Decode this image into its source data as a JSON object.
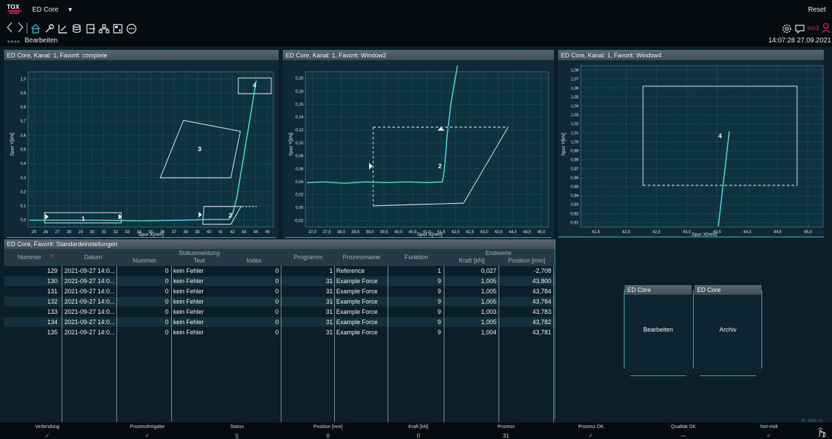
{
  "app": {
    "logo": "TOX",
    "title": "ED Core",
    "reset_label": "Reset",
    "breadcrumb": "Bearbeiten",
    "clock": "14:07:28  27.09.2021",
    "user": "tox3",
    "accent": "#3fb2b8",
    "brand": "#d4197a"
  },
  "toolbar": {
    "icons": [
      "home-icon",
      "wrench-icon",
      "edit-chart-icon",
      "database-icon",
      "export-icon",
      "network-icon",
      "calculator-icon",
      "more-icon"
    ]
  },
  "charts": [
    {
      "title": "ED Core,  Kanal: 1, Favorit: complete",
      "xlabel": "Spur X[mm]",
      "ylabel": "Spur Y[kN]",
      "xticks": [
        "25",
        "26",
        "27",
        "28",
        "29",
        "30",
        "31",
        "32",
        "33",
        "34",
        "35",
        "36",
        "37",
        "38",
        "39",
        "40",
        "41",
        "42",
        "43",
        "44",
        "45"
      ],
      "yticks": [
        "0,0",
        "0,1",
        "0,2",
        "0,3",
        "0,4",
        "0,5",
        "0,6",
        "0,7",
        "0,8",
        "0,9",
        "1,0"
      ],
      "window_labels": [
        "1",
        "2",
        "3",
        "4"
      ]
    },
    {
      "title": "ED Core,  Kanal: 1, Favorit: Window2",
      "xlabel": "Spur X[mm]",
      "ylabel": "Spur Y[kN]",
      "xticks": [
        "37,0",
        "37,5",
        "38,0",
        "38,5",
        "39,0",
        "39,5",
        "40,0",
        "40,5",
        "41,0",
        "41,5",
        "42,0",
        "42,5",
        "43,0",
        "43,5",
        "44,0",
        "44,5",
        "45,0"
      ],
      "yticks": [
        "-0,02",
        "0,00",
        "0,02",
        "0,04",
        "0,06",
        "0,08",
        "0,10",
        "0,12",
        "0,14",
        "0,16",
        "0,18",
        "0,20"
      ],
      "window_labels": [
        "2"
      ]
    },
    {
      "title": "ED Core,  Kanal: 1, Favorit: Window4",
      "xlabel": "Spur X[mm]",
      "ylabel": "Spur Y[kN]",
      "xticks": [
        "41,5",
        "42,0",
        "42,5",
        "43,0",
        "43,5",
        "44,0",
        "44,5",
        "45,0"
      ],
      "yticks": [
        "0,91",
        "0,92",
        "0,93",
        "0,94",
        "0,95",
        "0,96",
        "0,97",
        "0,98",
        "0,99",
        "1,00",
        "1,01",
        "1,02",
        "1,03",
        "1,04",
        "1,05",
        "1,06",
        "1,07",
        "1,08"
      ],
      "window_labels": [
        "4"
      ]
    }
  ],
  "table": {
    "title": "ED Core,  Favorit: Standardeinstellungen",
    "groups": {
      "status": "Statusmeldung",
      "endwerte": "Endwerte"
    },
    "columns": {
      "nummer": "Nummer",
      "datum": "Datum",
      "st_nummer": "Nummer",
      "st_text": "Text",
      "st_index": "Index",
      "programm": "Programm",
      "prozessname": "Prozessname",
      "funktion": "Funktion",
      "kraft": "Kraft [kN]",
      "position": "Position [mm]"
    },
    "rows": [
      {
        "nummer": "129",
        "datum": "2021-09-27 14:0...",
        "st_nummer": "0",
        "st_text": "kein Fehler",
        "st_index": "0",
        "programm": "1",
        "prozessname": "Reference",
        "funktion": "1",
        "kraft": "0,027",
        "position": "-2,708"
      },
      {
        "nummer": "130",
        "datum": "2021-09-27 14:0...",
        "st_nummer": "0",
        "st_text": "kein Fehler",
        "st_index": "0",
        "programm": "31",
        "prozessname": "Example Force",
        "funktion": "9",
        "kraft": "1,005",
        "position": "43,800"
      },
      {
        "nummer": "131",
        "datum": "2021-09-27 14:0...",
        "st_nummer": "0",
        "st_text": "kein Fehler",
        "st_index": "0",
        "programm": "31",
        "prozessname": "Example Force",
        "funktion": "9",
        "kraft": "1,005",
        "position": "43,784"
      },
      {
        "nummer": "132",
        "datum": "2021-09-27 14:0...",
        "st_nummer": "0",
        "st_text": "kein Fehler",
        "st_index": "0",
        "programm": "31",
        "prozessname": "Example Force",
        "funktion": "9",
        "kraft": "1,005",
        "position": "43,784"
      },
      {
        "nummer": "133",
        "datum": "2021-09-27 14:0...",
        "st_nummer": "0",
        "st_text": "kein Fehler",
        "st_index": "0",
        "programm": "31",
        "prozessname": "Example Force",
        "funktion": "9",
        "kraft": "1,003",
        "position": "43,783"
      },
      {
        "nummer": "134",
        "datum": "2021-09-27 14:0...",
        "st_nummer": "0",
        "st_text": "kein Fehler",
        "st_index": "0",
        "programm": "31",
        "prozessname": "Example Force",
        "funktion": "9",
        "kraft": "1,005",
        "position": "43,782"
      },
      {
        "nummer": "135",
        "datum": "2021-09-27 14:0...",
        "st_nummer": "0",
        "st_text": "kein Fehler",
        "st_index": "0",
        "programm": "31",
        "prozessname": "Example Force",
        "funktion": "9",
        "kraft": "1,004",
        "position": "43,781"
      }
    ]
  },
  "tiles": [
    {
      "header": "ED Core",
      "label": "Bearbeiten"
    },
    {
      "header": "ED Core",
      "label": "Archiv"
    }
  ],
  "status_bar": {
    "resolution": "W: 1920; H: 1017",
    "items": [
      {
        "label": "Verbindung",
        "value": "✓"
      },
      {
        "label": "Prozessfreigabe",
        "value": "✓"
      },
      {
        "label": "Status",
        "value": "||"
      },
      {
        "label": "Position [mm]",
        "value": "0"
      },
      {
        "label": "Kraft [kN]",
        "value": "0"
      },
      {
        "label": "Prozess",
        "value": "31"
      },
      {
        "label": "Prozess OK",
        "value": "✓"
      },
      {
        "label": "Qualität OK",
        "value": "—"
      },
      {
        "label": "Not-Halt",
        "value": "✓"
      }
    ]
  }
}
